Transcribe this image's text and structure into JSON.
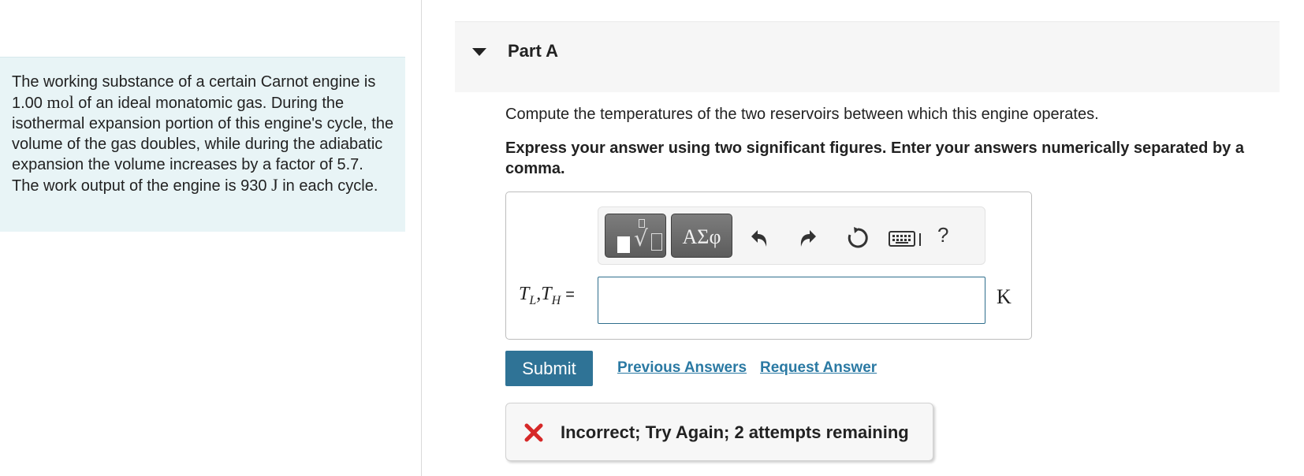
{
  "problem": {
    "text_part1": "The working substance of a certain Carnot engine is 1.00 ",
    "unit_mol": "mol",
    "text_part2": " of an ideal monatomic gas. During the isothermal expansion portion of this engine's cycle, the volume of the gas doubles, while during the adiabatic expansion the volume increases by a factor of 5.7. The work output of the engine is 930 ",
    "unit_J": "J",
    "text_part3": " in each cycle."
  },
  "part": {
    "title": "Part A",
    "question": "Compute the temperatures of the two reservoirs between which this engine operates.",
    "instructions": "Express your answer using two significant figures. Enter your answers numerically separated by a comma."
  },
  "toolbar": {
    "greek_label": "ΑΣφ",
    "help_label": "?"
  },
  "answer": {
    "var_T1": "T",
    "var_T1_sub": "L",
    "var_sep": ",",
    "var_T2": "T",
    "var_T2_sub": "H",
    "equals": "=",
    "value": "",
    "unit": "K"
  },
  "actions": {
    "submit_label": "Submit",
    "previous_answers_label": "Previous Answers",
    "request_answer_label": "Request Answer"
  },
  "feedback": {
    "message": "Incorrect; Try Again; 2 attempts remaining",
    "status_color": "#d62828"
  },
  "colors": {
    "problem_bg": "#e8f4f6",
    "link": "#2a79a3",
    "submit_bg": "#2f7396"
  }
}
